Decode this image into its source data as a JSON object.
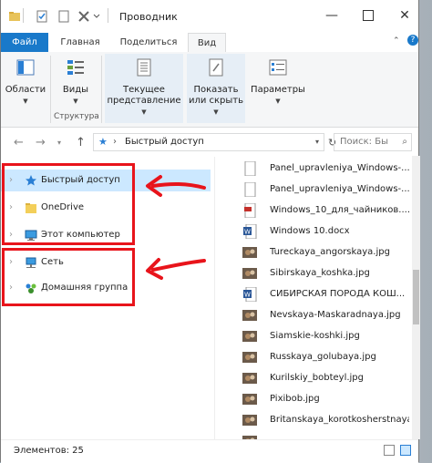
{
  "window": {
    "title": "Проводник"
  },
  "tabs": {
    "file": "Файл",
    "home": "Главная",
    "share": "Поделиться",
    "view": "Вид"
  },
  "ribbon": {
    "panels": "Области",
    "layouts": "Виды",
    "current_view_1": "Текущее",
    "current_view_2": "представление",
    "show_hide_1": "Показать",
    "show_hide_2": "или скрыть",
    "options": "Параметры",
    "group_structure": "Структура"
  },
  "address": {
    "path": "Быстрый доступ",
    "search_placeholder": "Поиск: Бы"
  },
  "nav": {
    "quick_access": "Быстрый доступ",
    "onedrive": "OneDrive",
    "this_pc": "Этот компьютер",
    "network": "Сеть",
    "homegroup": "Домашняя группа"
  },
  "files": [
    {
      "name": "Panel_upravleniya_Windows-...",
      "icon": "doc-icon"
    },
    {
      "name": "Panel_upravleniya_Windows-...",
      "icon": "doc-icon"
    },
    {
      "name": "Windows_10_для_чайников....",
      "icon": "pdf-icon"
    },
    {
      "name": "Windows 10.docx",
      "icon": "word-icon"
    },
    {
      "name": "Tureckaya_angorskaya.jpg",
      "icon": "image-icon"
    },
    {
      "name": "Sibirskaya_koshka.jpg",
      "icon": "image-icon"
    },
    {
      "name": "СИБИРСКАЯ ПОРОДА КОШ...",
      "icon": "word-icon"
    },
    {
      "name": "Nevskaya-Maskaradnaya.jpg",
      "icon": "image-icon"
    },
    {
      "name": "Siamskie-koshki.jpg",
      "icon": "image-icon"
    },
    {
      "name": "Russkaya_golubaya.jpg",
      "icon": "image-icon"
    },
    {
      "name": "Kurilskiy_bobteyl.jpg",
      "icon": "image-icon"
    },
    {
      "name": "Pixibob.jpg",
      "icon": "image-icon"
    },
    {
      "name": "Britanskaya_korotkosherstnaya...",
      "icon": "image-icon"
    },
    {
      "name": "",
      "icon": "image-icon"
    }
  ],
  "status": {
    "count": "Элементов: 25"
  },
  "colors": {
    "accent": "#1979ca",
    "selection": "#cce8ff",
    "annotation": "#e8141b"
  }
}
